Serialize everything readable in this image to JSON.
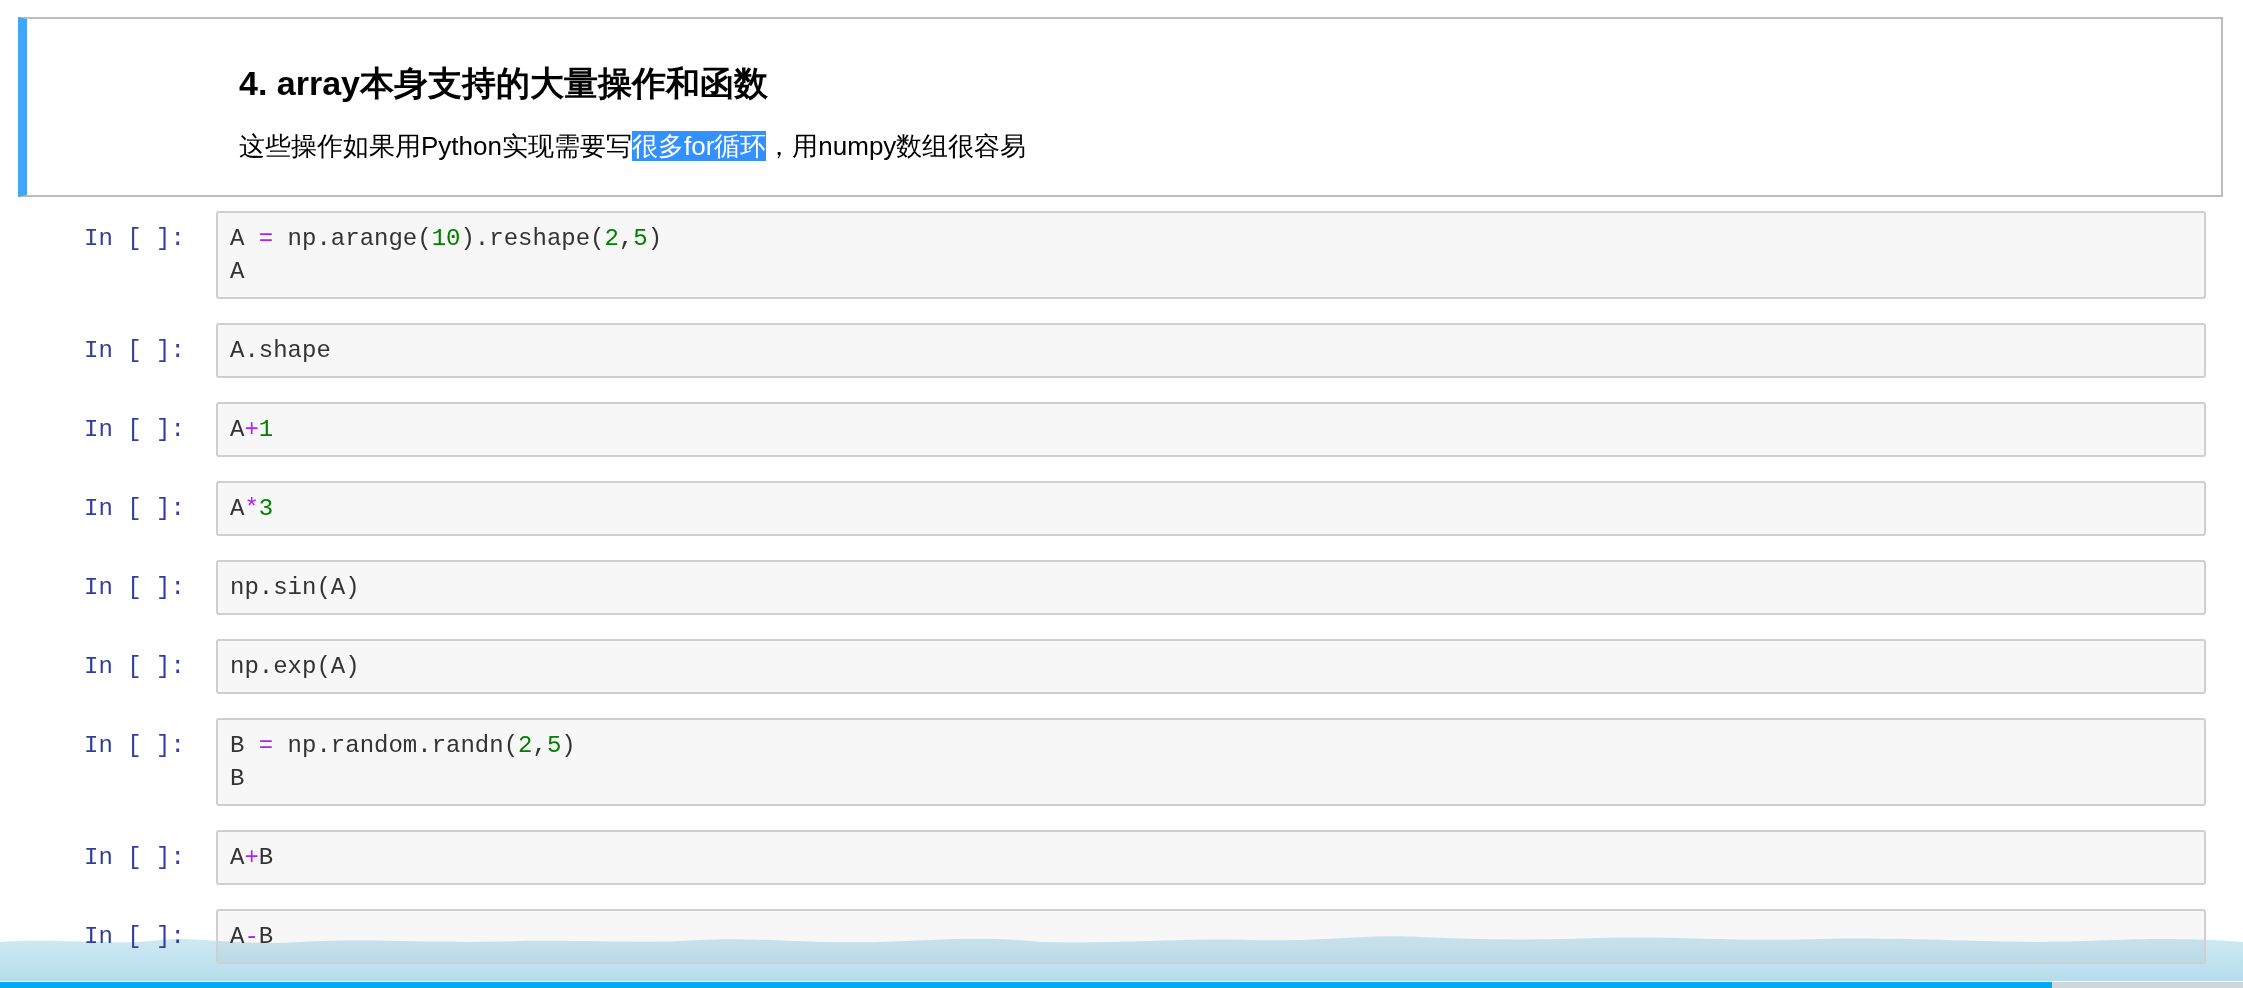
{
  "markdown_cell": {
    "heading": "4. array本身支持的大量操作和函数",
    "paragraph": [
      {
        "text": "这些操作如果用Python实现需要写",
        "selected": false
      },
      {
        "text": "很多for循环",
        "selected": true
      },
      {
        "text": "，用numpy数组很容易",
        "selected": false
      }
    ]
  },
  "code_cells": [
    {
      "prompt": "In [ ]:",
      "lines": [
        [
          {
            "kind": "name",
            "text": "A "
          },
          {
            "kind": "op",
            "text": "="
          },
          {
            "kind": "name",
            "text": " np.arange("
          },
          {
            "kind": "num",
            "text": "10"
          },
          {
            "kind": "name",
            "text": ").reshape("
          },
          {
            "kind": "num",
            "text": "2"
          },
          {
            "kind": "name",
            "text": ","
          },
          {
            "kind": "num",
            "text": "5"
          },
          {
            "kind": "name",
            "text": ")"
          }
        ],
        [
          {
            "kind": "name",
            "text": "A"
          }
        ]
      ]
    },
    {
      "prompt": "In [ ]:",
      "lines": [
        [
          {
            "kind": "name",
            "text": "A.shape"
          }
        ]
      ]
    },
    {
      "prompt": "In [ ]:",
      "lines": [
        [
          {
            "kind": "name",
            "text": "A"
          },
          {
            "kind": "op",
            "text": "+"
          },
          {
            "kind": "num",
            "text": "1"
          }
        ]
      ]
    },
    {
      "prompt": "In [ ]:",
      "lines": [
        [
          {
            "kind": "name",
            "text": "A"
          },
          {
            "kind": "op",
            "text": "*"
          },
          {
            "kind": "num",
            "text": "3"
          }
        ]
      ]
    },
    {
      "prompt": "In [ ]:",
      "lines": [
        [
          {
            "kind": "name",
            "text": "np.sin(A)"
          }
        ]
      ]
    },
    {
      "prompt": "In [ ]:",
      "lines": [
        [
          {
            "kind": "name",
            "text": "np.exp(A)"
          }
        ]
      ]
    },
    {
      "prompt": "In [ ]:",
      "lines": [
        [
          {
            "kind": "name",
            "text": "B "
          },
          {
            "kind": "op",
            "text": "="
          },
          {
            "kind": "name",
            "text": " np.random.randn("
          },
          {
            "kind": "num",
            "text": "2"
          },
          {
            "kind": "name",
            "text": ","
          },
          {
            "kind": "num",
            "text": "5"
          },
          {
            "kind": "name",
            "text": ")"
          }
        ],
        [
          {
            "kind": "name",
            "text": "B"
          }
        ]
      ]
    },
    {
      "prompt": "In [ ]:",
      "lines": [
        [
          {
            "kind": "name",
            "text": "A"
          },
          {
            "kind": "op",
            "text": "+"
          },
          {
            "kind": "name",
            "text": "B"
          }
        ]
      ]
    },
    {
      "prompt": "In [ ]:",
      "lines": [
        [
          {
            "kind": "name",
            "text": "A"
          },
          {
            "kind": "op",
            "text": "-"
          },
          {
            "kind": "name",
            "text": "B"
          }
        ]
      ]
    }
  ],
  "video_progress": {
    "level": 0.915
  }
}
